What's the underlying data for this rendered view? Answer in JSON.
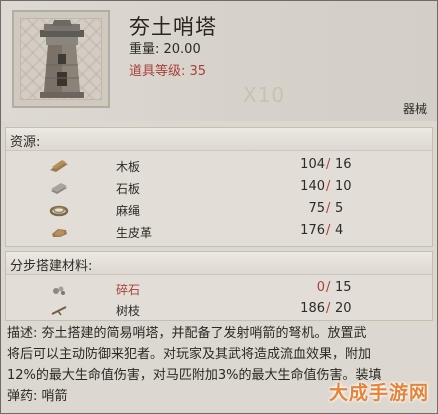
{
  "item": {
    "title": "夯土哨塔",
    "weight_label": "重量: 20.00",
    "level_label": "道具等级: 35",
    "watermark": "X10",
    "category": "器械"
  },
  "resources": {
    "header": "资源:",
    "items": [
      {
        "name": "木板",
        "have": "104",
        "need": "16",
        "icon": "wood-plank-icon"
      },
      {
        "name": "石板",
        "have": "140",
        "need": "10",
        "icon": "stone-slab-icon"
      },
      {
        "name": "麻绳",
        "have": "75",
        "need": "5",
        "icon": "rope-icon"
      },
      {
        "name": "生皮革",
        "have": "176",
        "need": "4",
        "icon": "rawhide-icon"
      }
    ]
  },
  "build_materials": {
    "header": "分步搭建材料:",
    "items": [
      {
        "name": "碎石",
        "have": "0",
        "need": "15",
        "icon": "gravel-icon",
        "insufficient": true
      },
      {
        "name": "树枝",
        "have": "186",
        "need": "20",
        "icon": "branch-icon"
      }
    ]
  },
  "description": {
    "line1": "描述: 夯土搭建的简易哨塔，并配备了发射哨箭的弩机。放置武",
    "line2": "将后可以主动防御来犯者。对玩家及其武将造成流血效果，附加",
    "line3": "12%的最大生命值伤害，对马匹附加3%的最大生命值伤害。装填",
    "line4": "弹药: 哨箭"
  },
  "logo": {
    "text": "大成手游网"
  },
  "colors": {
    "accent_red": "#a8403c",
    "text": "#2e2a25",
    "panel": "#e2ded7"
  }
}
